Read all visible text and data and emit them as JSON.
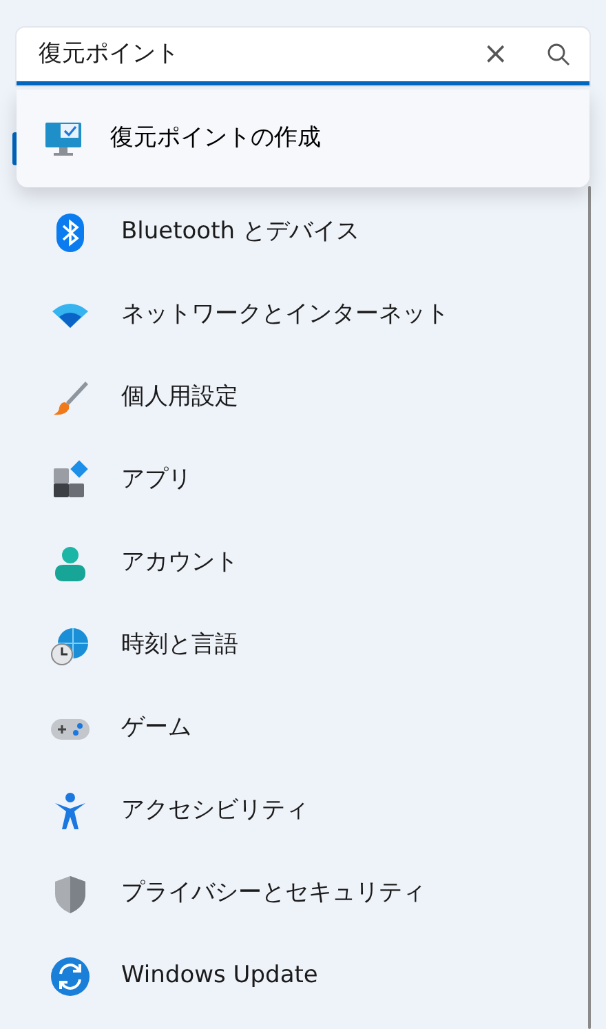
{
  "search": {
    "value": "復元ポイント",
    "clear_label": "×"
  },
  "suggestions": [
    {
      "label": "復元ポイントの作成"
    }
  ],
  "nav_items": [
    {
      "label": "Bluetooth とデバイス"
    },
    {
      "label": "ネットワークとインターネット"
    },
    {
      "label": "個人用設定"
    },
    {
      "label": "アプリ"
    },
    {
      "label": "アカウント"
    },
    {
      "label": "時刻と言語"
    },
    {
      "label": "ゲーム"
    },
    {
      "label": "アクセシビリティ"
    },
    {
      "label": "プライバシーとセキュリティ"
    },
    {
      "label": "Windows Update"
    }
  ]
}
